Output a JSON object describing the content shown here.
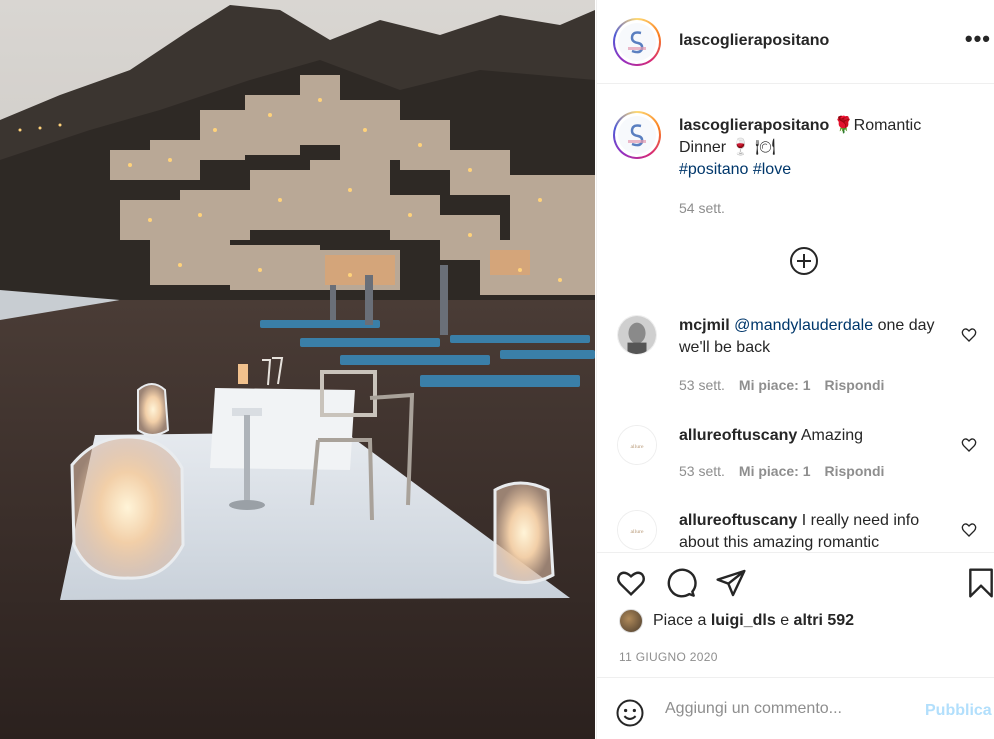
{
  "post": {
    "username": "lascoglierapositano",
    "more_label": "•••"
  },
  "caption": {
    "username": "lascoglierapositano",
    "emoji_rose": "🌹",
    "text_1": "Romantic",
    "text_2": "Dinner",
    "emoji_wine": "🍷",
    "emoji_plate": "🍽",
    "hashtag_1": "#positano",
    "hashtag_2": "#love",
    "time": "54 sett."
  },
  "comments": [
    {
      "username": "mcjmil",
      "mention": "@mandylauderdale",
      "text": " one day we'll be back",
      "time": "53 sett.",
      "likes": "Mi piace: 1",
      "reply": "Rispondi"
    },
    {
      "username": "allureoftuscany",
      "text": "Amazing",
      "time": "53 sett.",
      "likes": "Mi piace: 1",
      "reply": "Rispondi"
    },
    {
      "username": "allureoftuscany",
      "text": "I really need info about this amazing romantic"
    }
  ],
  "likes": {
    "prefix": "Piace a ",
    "user": "luigi_dls",
    "middle": " e ",
    "others": "altri 592"
  },
  "date": "11 GIUGNO 2020",
  "add_comment": {
    "placeholder": "Aggiungi un commento...",
    "publish": "Pubblica"
  },
  "colors": {
    "link": "#00376b",
    "muted": "#8e8e8e",
    "publish_disabled": "#b2dffc"
  }
}
